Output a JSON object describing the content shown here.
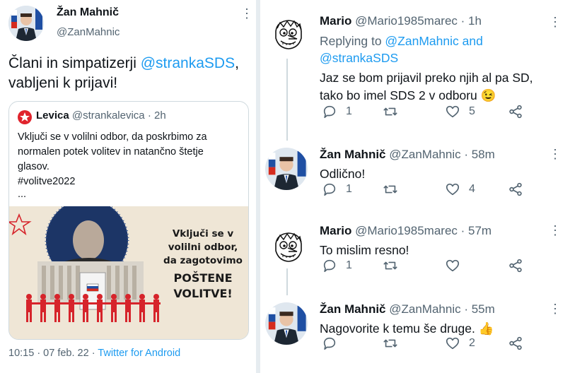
{
  "left_tweet": {
    "author_name": "Žan Mahnič",
    "author_handle": "@ZanMahnic",
    "text_prefix": "Člani in simpatizerji ",
    "text_mention": "@strankaSDS",
    "text_suffix": ",",
    "text_line2": "vabljeni k prijavi!",
    "quote": {
      "author_name": "Levica",
      "author_handle": "@strankalevica",
      "time": "· 2h",
      "lines": [
        "Vključi se v volilni odbor, da poskrbimo za",
        "normalen potek volitev in natančno štetje",
        "glasov.",
        "#volitve2022",
        "..."
      ],
      "image_text": [
        "Vključi se v",
        "volilni odbor,",
        "da zagotovimo",
        "POŠTENE",
        "VOLITVE!"
      ]
    },
    "meta": {
      "datetime": "10:15 · 07 feb. 22 · ",
      "client": "Twitter for Android"
    }
  },
  "replies": [
    {
      "author_name": "Mario",
      "author_handle": "@Mario1985marec",
      "time": "· 1h",
      "replying_prefix": "Replying to ",
      "replying_mention1": "@ZanMahnic",
      "replying_and": " and",
      "replying_mention2": "@strankaSDS",
      "lines": [
        "Jaz se bom prijavil preko njih al pa SD,",
        "tako bo imel SDS 2 v odboru 😉"
      ],
      "reply_count": "1",
      "retweet_count": "",
      "like_count": "5"
    },
    {
      "author_name": "Žan Mahnič",
      "author_handle": "@ZanMahnic",
      "time": "· 58m",
      "lines": [
        "Odlično!"
      ],
      "reply_count": "1",
      "retweet_count": "",
      "like_count": "4"
    },
    {
      "author_name": "Mario",
      "author_handle": "@Mario1985marec",
      "time": "· 57m",
      "lines": [
        "To mislim resno!"
      ],
      "reply_count": "1",
      "retweet_count": "",
      "like_count": ""
    },
    {
      "author_name": "Žan Mahnič",
      "author_handle": "@ZanMahnic",
      "time": "· 55m",
      "lines": [
        "Nagovorite k temu še druge. 👍"
      ],
      "reply_count": "",
      "retweet_count": "",
      "like_count": "2"
    }
  ],
  "colors": {
    "link": "#1d9bf0",
    "secondary": "#536471",
    "levica_red": "#e0232c"
  }
}
